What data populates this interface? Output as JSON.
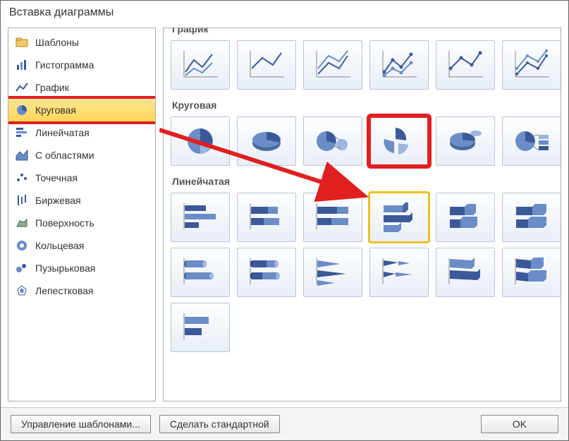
{
  "title": "Вставка диаграммы",
  "sidebar": {
    "items": [
      {
        "label": "Шаблоны",
        "icon": "folder-icon"
      },
      {
        "label": "Гистограмма",
        "icon": "bar-icon"
      },
      {
        "label": "График",
        "icon": "line-icon"
      },
      {
        "label": "Круговая",
        "icon": "pie-icon"
      },
      {
        "label": "Линейчатая",
        "icon": "hbar-icon"
      },
      {
        "label": "С областями",
        "icon": "area-icon"
      },
      {
        "label": "Точечная",
        "icon": "scatter-icon"
      },
      {
        "label": "Биржевая",
        "icon": "stock-icon"
      },
      {
        "label": "Поверхность",
        "icon": "surface-icon"
      },
      {
        "label": "Кольцевая",
        "icon": "donut-icon"
      },
      {
        "label": "Пузырьковая",
        "icon": "bubble-icon"
      },
      {
        "label": "Лепестковая",
        "icon": "radar-icon"
      }
    ],
    "selected_index": 3
  },
  "sections": [
    {
      "title": "График",
      "cut": true
    },
    {
      "title": "Круговая"
    },
    {
      "title": "Линейчатая"
    }
  ],
  "buttons": {
    "manage_templates": "Управление шаблонами...",
    "set_default": "Сделать стандартной",
    "ok": "OK"
  },
  "highlight": {
    "red_thumb_section": 1,
    "red_thumb_index": 3,
    "yellow_thumb_section": 2,
    "yellow_thumb_index": 3
  }
}
